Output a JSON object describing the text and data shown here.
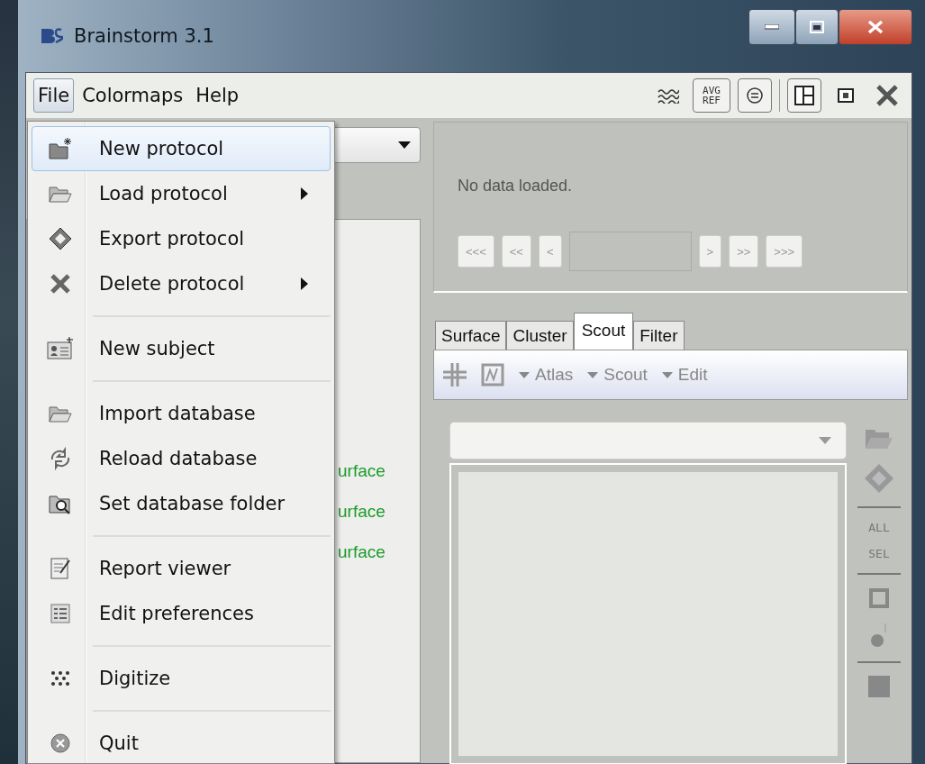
{
  "window": {
    "title": "Brainstorm 3.1"
  },
  "menu_bar": [
    {
      "label": "File",
      "selected": true
    },
    {
      "label": "Colormaps",
      "selected": false
    },
    {
      "label": "Help",
      "selected": false
    }
  ],
  "toolbar": [
    {
      "kind": "waves"
    },
    {
      "kind": "text",
      "lines": [
        "AVG",
        "REF"
      ]
    },
    {
      "kind": "circle"
    },
    {
      "kind": "divider"
    },
    {
      "kind": "layout"
    },
    {
      "kind": "small"
    },
    {
      "kind": "close"
    }
  ],
  "file_menu": [
    {
      "kind": "item",
      "label": "New protocol",
      "submenu": false,
      "selected": true
    },
    {
      "kind": "item",
      "label": "Load protocol",
      "submenu": true,
      "selected": false
    },
    {
      "kind": "item",
      "label": "Export protocol",
      "submenu": false,
      "selected": false
    },
    {
      "kind": "item",
      "label": "Delete protocol",
      "submenu": true,
      "selected": false
    },
    {
      "kind": "separator"
    },
    {
      "kind": "item",
      "label": "New subject",
      "submenu": false,
      "selected": false
    },
    {
      "kind": "separator"
    },
    {
      "kind": "item",
      "label": "Import database",
      "submenu": false,
      "selected": false
    },
    {
      "kind": "item",
      "label": "Reload database",
      "submenu": false,
      "selected": false
    },
    {
      "kind": "item",
      "label": "Set database folder",
      "submenu": false,
      "selected": false
    },
    {
      "kind": "separator"
    },
    {
      "kind": "item",
      "label": "Report viewer",
      "submenu": false,
      "selected": false
    },
    {
      "kind": "item",
      "label": "Edit preferences",
      "submenu": false,
      "selected": false
    },
    {
      "kind": "separator"
    },
    {
      "kind": "item",
      "label": "Digitize",
      "submenu": false,
      "selected": false
    },
    {
      "kind": "separator"
    },
    {
      "kind": "item",
      "label": "Quit",
      "submenu": false,
      "selected": false
    }
  ],
  "tree_items": [
    "urface",
    "urface",
    "urface"
  ],
  "viewer": {
    "status": "No data loaded.",
    "back_buttons": [
      "<<<",
      "<<",
      "<"
    ],
    "forward_buttons": [
      ">",
      ">>",
      ">>>"
    ]
  },
  "tabs": [
    {
      "label": "Surface",
      "selected": false
    },
    {
      "label": "Cluster",
      "selected": false
    },
    {
      "label": "Scout",
      "selected": true
    },
    {
      "label": "Filter",
      "selected": false
    }
  ],
  "scout_toolbar": {
    "menus": [
      "Atlas",
      "Scout",
      "Edit"
    ]
  },
  "side_tools": [
    {
      "kind": "folder"
    },
    {
      "kind": "save"
    },
    {
      "kind": "separator"
    },
    {
      "kind": "text",
      "label": "ALL"
    },
    {
      "kind": "text",
      "label": "SEL"
    },
    {
      "kind": "separator"
    },
    {
      "kind": "square"
    },
    {
      "kind": "dot"
    },
    {
      "kind": "separator"
    },
    {
      "kind": "filled"
    }
  ]
}
